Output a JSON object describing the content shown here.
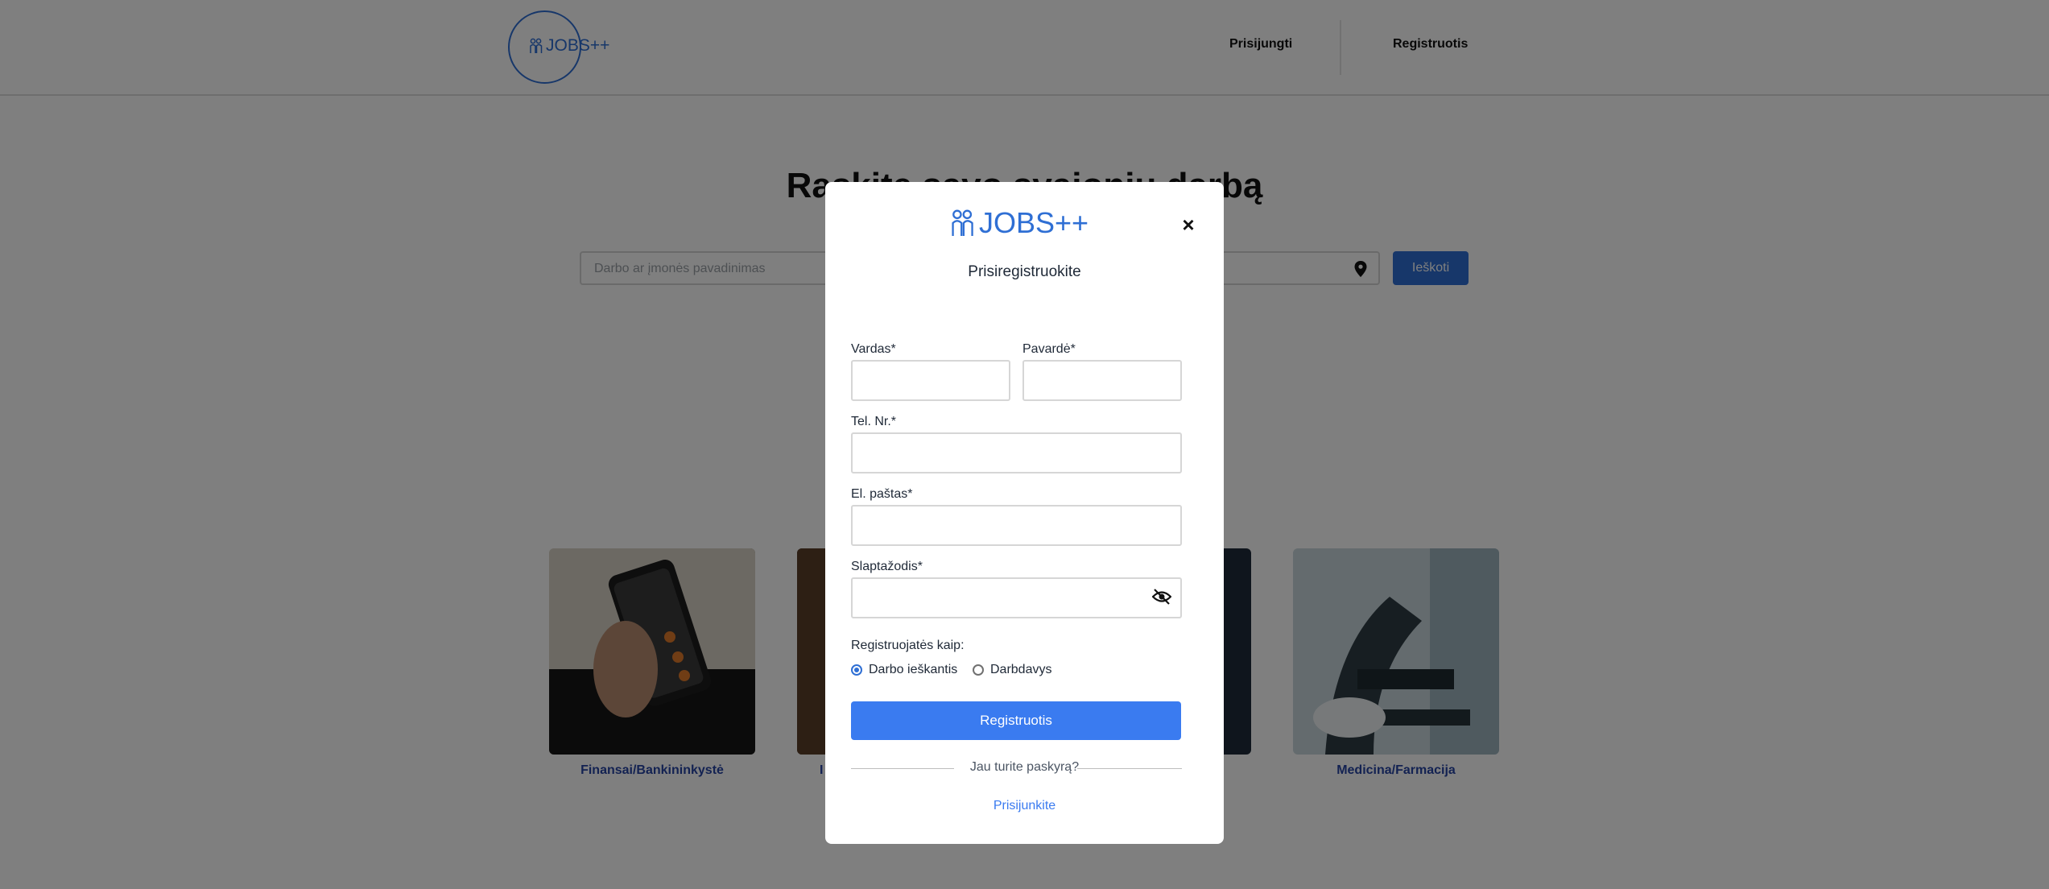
{
  "header": {
    "logo_text": "JOBS++",
    "nav": {
      "login": "Prisijungti",
      "register": "Registruotis"
    }
  },
  "hero": {
    "title": "Raskite savo svajonių darbą",
    "search_placeholder": "Darbo ar įmonės pavadinimas",
    "search_button": "Ieškoti"
  },
  "categories": [
    {
      "label": "Finansai/Bankininkystė"
    },
    {
      "label": "I"
    },
    {
      "label": ""
    },
    {
      "label": "Medicina/Farmacija"
    }
  ],
  "modal": {
    "logo_text": "JOBS++",
    "close": "×",
    "title": "Prisiregistruokite",
    "fields": {
      "first_name": {
        "label": "Vardas*",
        "value": ""
      },
      "last_name": {
        "label": "Pavardė*",
        "value": ""
      },
      "phone": {
        "label": "Tel. Nr.*",
        "value": ""
      },
      "email": {
        "label": "El. paštas*",
        "value": ""
      },
      "password": {
        "label": "Slaptažodis*",
        "value": ""
      }
    },
    "role": {
      "label": "Registruojatės kaip:",
      "options": [
        {
          "label": "Darbo ieškantis",
          "selected": true
        },
        {
          "label": "Darbdavys",
          "selected": false
        }
      ]
    },
    "submit": "Registruotis",
    "have_account": "Jau turite paskyrą?",
    "login_link": "Prisijunkite"
  },
  "colors": {
    "brand": "#2f6fd4",
    "button": "#3a7bf0",
    "category_label": "#2744a4",
    "overlay": "rgba(0,0,0,0.5)"
  }
}
